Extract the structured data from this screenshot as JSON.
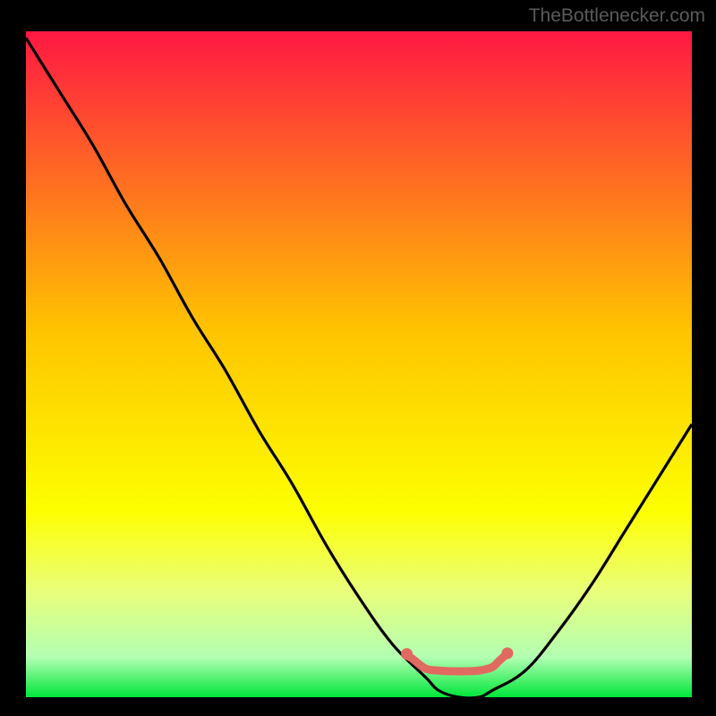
{
  "watermark": "TheBottlenecker.com",
  "chart_data": {
    "type": "line",
    "title": "",
    "xlabel": "",
    "ylabel": "",
    "x_range": [
      0,
      100
    ],
    "y_range": [
      0,
      100
    ],
    "gradient_stops": [
      {
        "offset": 0,
        "color": "#ff1843"
      },
      {
        "offset": 0.45,
        "color": "#ffc400"
      },
      {
        "offset": 0.72,
        "color": "#fdff00"
      },
      {
        "offset": 0.84,
        "color": "#eaff7a"
      },
      {
        "offset": 0.94,
        "color": "#b3ffb3"
      },
      {
        "offset": 1.0,
        "color": "#00e63a"
      }
    ],
    "series": [
      {
        "name": "bottleneck-curve",
        "x": [
          0,
          5,
          10,
          15,
          20,
          25,
          30,
          35,
          40,
          45,
          50,
          55,
          60,
          62,
          65,
          68,
          70,
          75,
          80,
          85,
          90,
          95,
          100
        ],
        "y": [
          99,
          91,
          83,
          74,
          66,
          57,
          49,
          40,
          32,
          23,
          15,
          8,
          3,
          1,
          0,
          0,
          1,
          4,
          10,
          17,
          25,
          33,
          41
        ]
      }
    ],
    "markers": {
      "name": "highlight-segment",
      "color": "#e06a5f",
      "points": [
        {
          "x": 57,
          "y": 6.3
        },
        {
          "x": 58,
          "y": 5.8
        },
        {
          "x": 60,
          "y": 4.3
        },
        {
          "x": 62,
          "y": 4.0
        },
        {
          "x": 64,
          "y": 3.9
        },
        {
          "x": 66,
          "y": 3.9
        },
        {
          "x": 68,
          "y": 4.0
        },
        {
          "x": 70,
          "y": 4.5
        },
        {
          "x": 71,
          "y": 5.4
        },
        {
          "x": 72,
          "y": 6.3
        }
      ],
      "dot_points": [
        {
          "x": 57.2,
          "y": 6.5
        },
        {
          "x": 72.3,
          "y": 6.6
        }
      ]
    }
  }
}
